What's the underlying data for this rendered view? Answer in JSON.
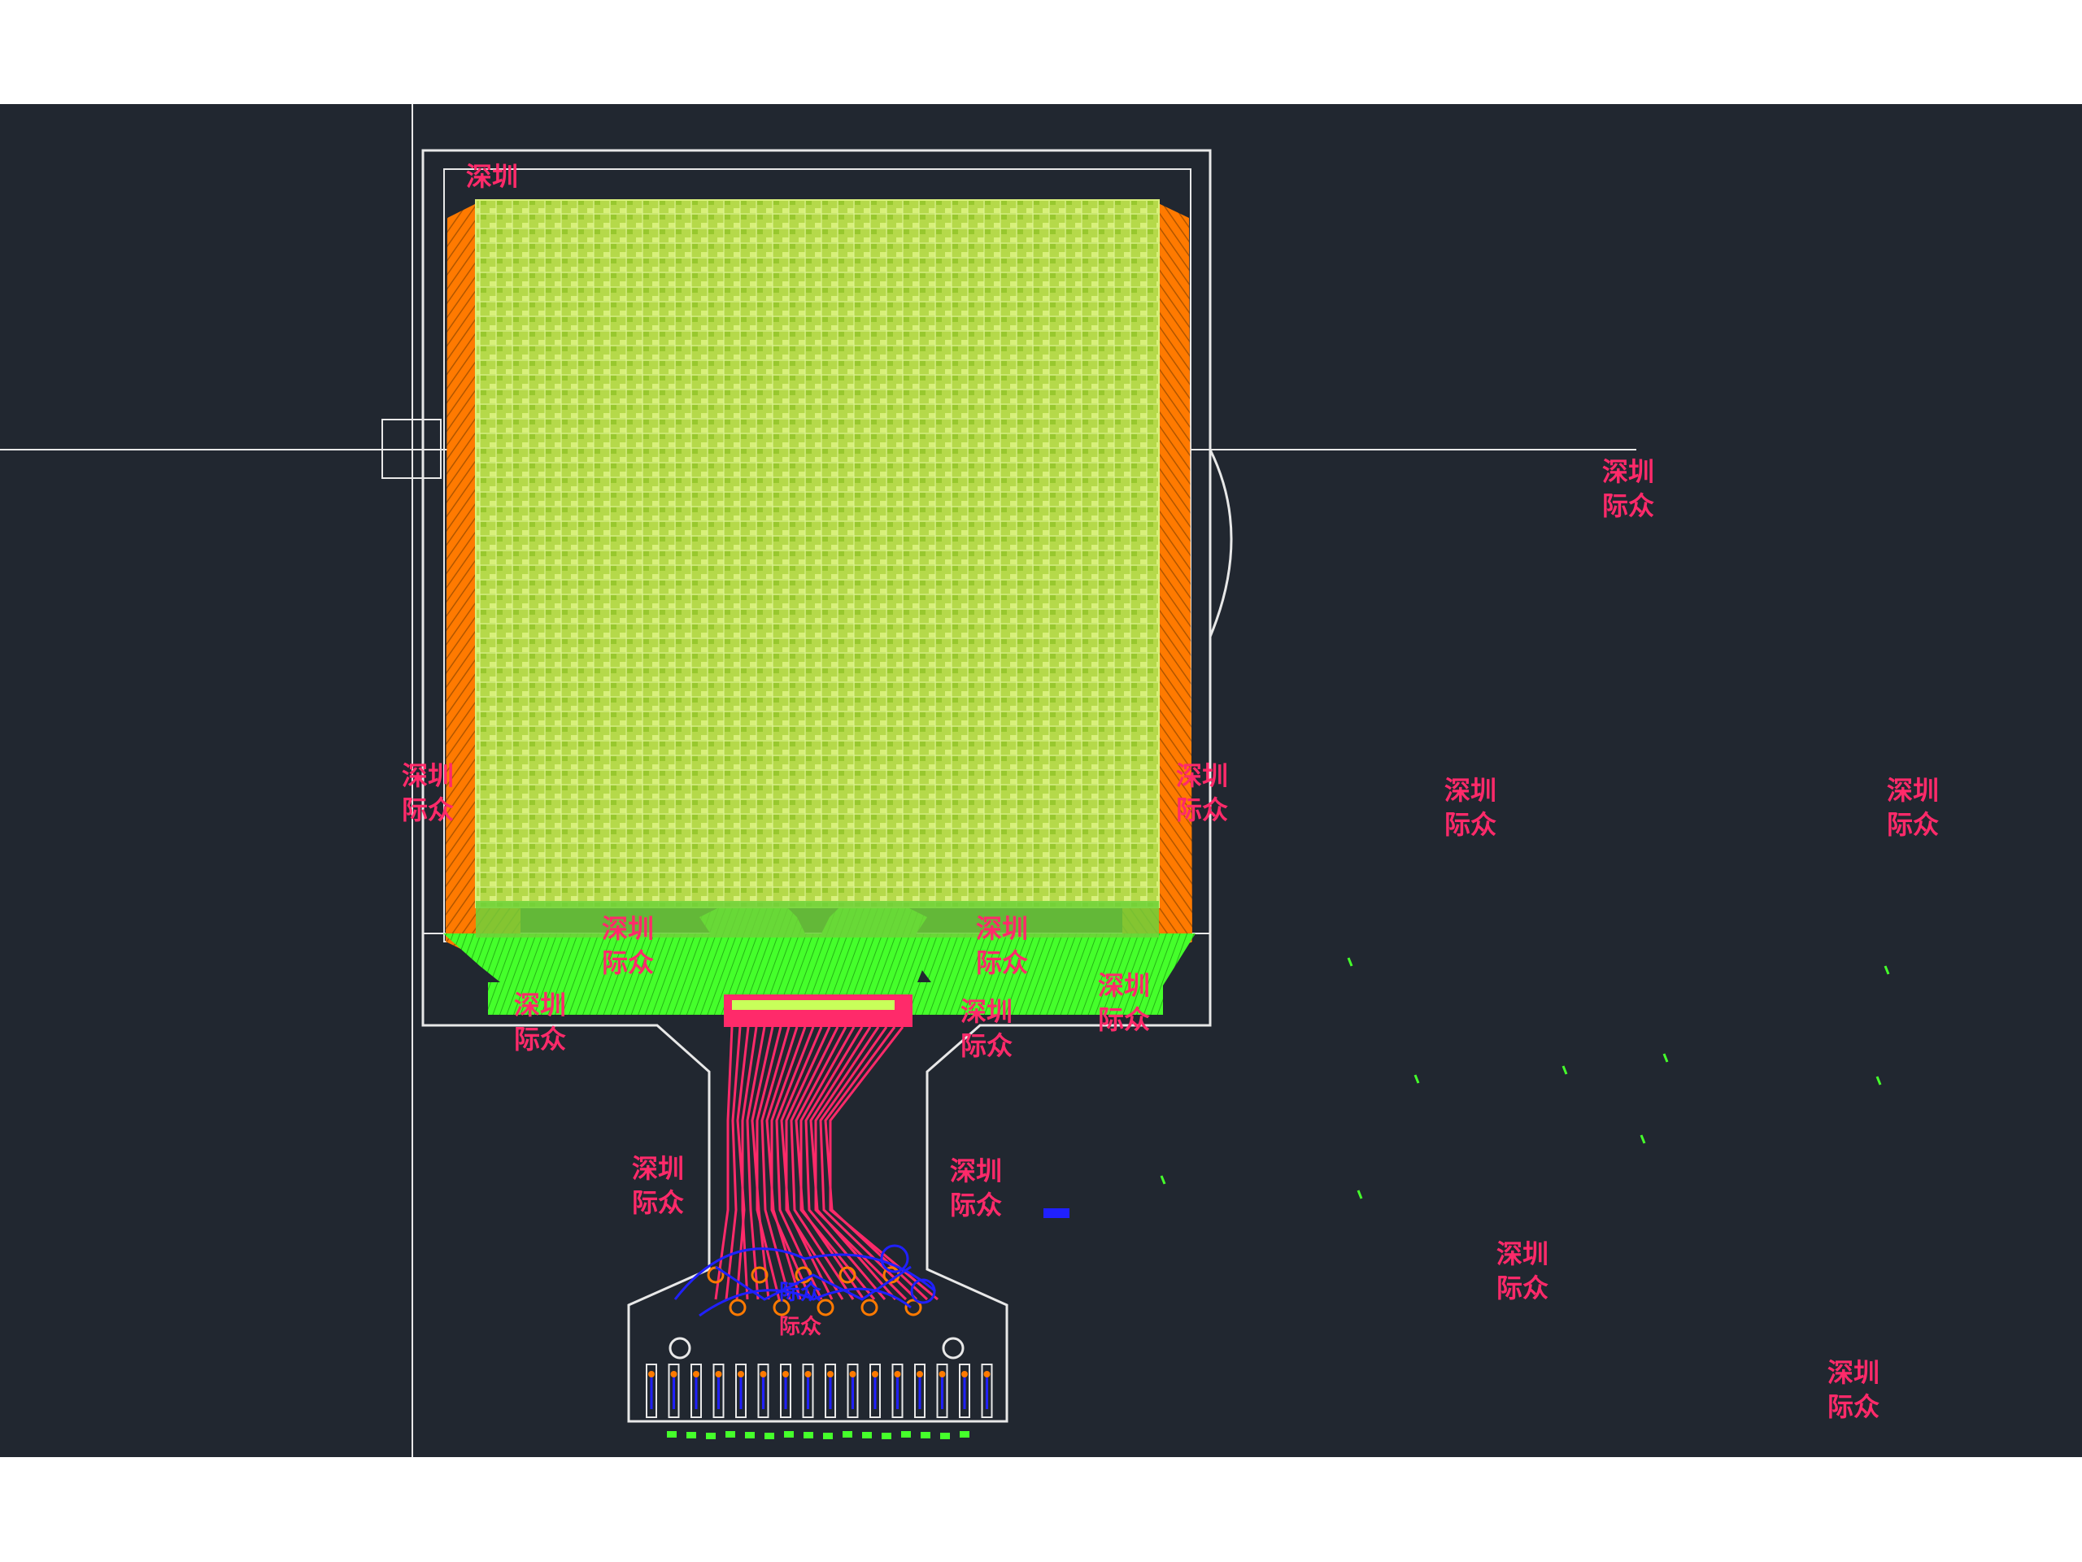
{
  "viewport": {
    "background": "#212730",
    "outline_color": "#e8e8e8",
    "mesh_color": "#c2ea55",
    "ground_color": "#45ff2b",
    "fan_color": "#ff7a00",
    "trace_color": "#ff2a6a",
    "via_color": "#2020ff"
  },
  "watermarks": [
    {
      "line1": "深圳",
      "line2": "际众"
    },
    {
      "line1": "深圳",
      "line2": "际众"
    },
    {
      "line1": "深圳",
      "line2": "际众"
    },
    {
      "line1": "深圳",
      "line2": "际众"
    },
    {
      "line1": "深圳",
      "line2": "际众"
    },
    {
      "line1": "深圳",
      "line2": "际众"
    },
    {
      "line1": "深圳",
      "line2": "际众"
    },
    {
      "line1": "深圳",
      "line2": "际众"
    },
    {
      "line1": "深圳",
      "line2": "际众"
    },
    {
      "line1": "深圳",
      "line2": "际众"
    },
    {
      "line1": "深圳",
      "line2": "际众"
    },
    {
      "line1": "深圳",
      "line2": "际众"
    },
    {
      "line1": "深圳",
      "line2": "际众"
    },
    {
      "line1": "深圳",
      "line2": "际众"
    },
    {
      "line1": "深圳",
      "line2": "际众"
    }
  ],
  "top_label": "深圳",
  "fpc_label": {
    "line1": "际众",
    "line2": "际众"
  }
}
